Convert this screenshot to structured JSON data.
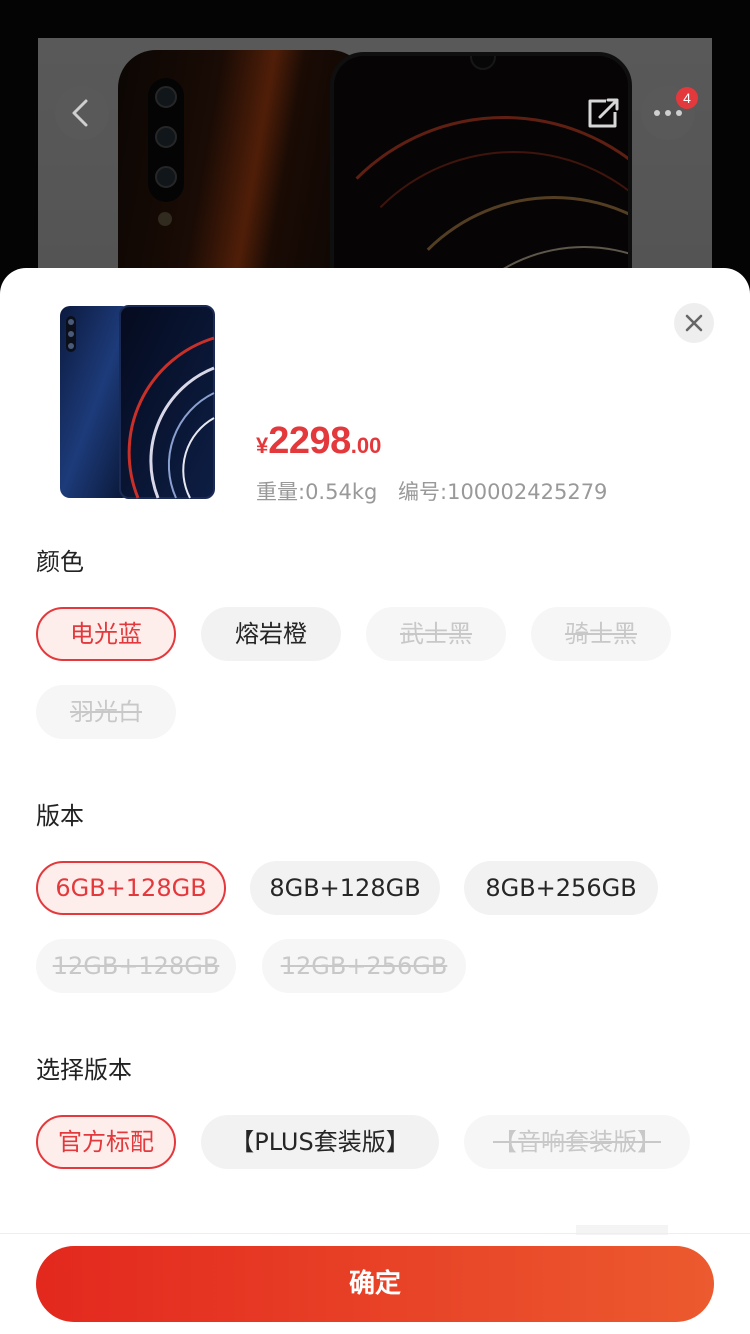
{
  "sheet": {
    "price": {
      "currency": "¥",
      "integer": "2298",
      "decimal": ".00"
    },
    "weight": "重量:0.54kg",
    "sku": "编号:100002425279"
  },
  "sections": {
    "color": {
      "title": "颜色",
      "options": [
        {
          "label": "电光蓝",
          "state": "selected"
        },
        {
          "label": "熔岩橙",
          "state": "available"
        },
        {
          "label": "武士黑",
          "state": "disabled"
        },
        {
          "label": "骑士黑",
          "state": "disabled"
        },
        {
          "label": "羽光白",
          "state": "disabled"
        }
      ]
    },
    "edition": {
      "title": "版本",
      "options": [
        {
          "label": "6GB+128GB",
          "state": "selected"
        },
        {
          "label": "8GB+128GB",
          "state": "available"
        },
        {
          "label": "8GB+256GB",
          "state": "available"
        },
        {
          "label": "12GB+128GB",
          "state": "disabled"
        },
        {
          "label": "12GB+256GB",
          "state": "disabled"
        }
      ]
    },
    "package": {
      "title": "选择版本",
      "options": [
        {
          "label": "官方标配",
          "state": "selected"
        },
        {
          "label": "【PLUS套装版】",
          "state": "available"
        },
        {
          "label": "【音响套装版】",
          "state": "disabled"
        }
      ]
    }
  },
  "header": {
    "cart_badge": "4"
  },
  "footer": {
    "confirm_label": "确定"
  },
  "colors": {
    "accent": "#e4393c",
    "selected_bg": "#fdeeec",
    "chip_bg": "#f2f2f2",
    "disabled_text": "#c8c8c8"
  },
  "icons": {
    "back": "chevron-left-icon",
    "share": "share-icon",
    "more": "more-dots-icon",
    "close": "close-icon"
  }
}
